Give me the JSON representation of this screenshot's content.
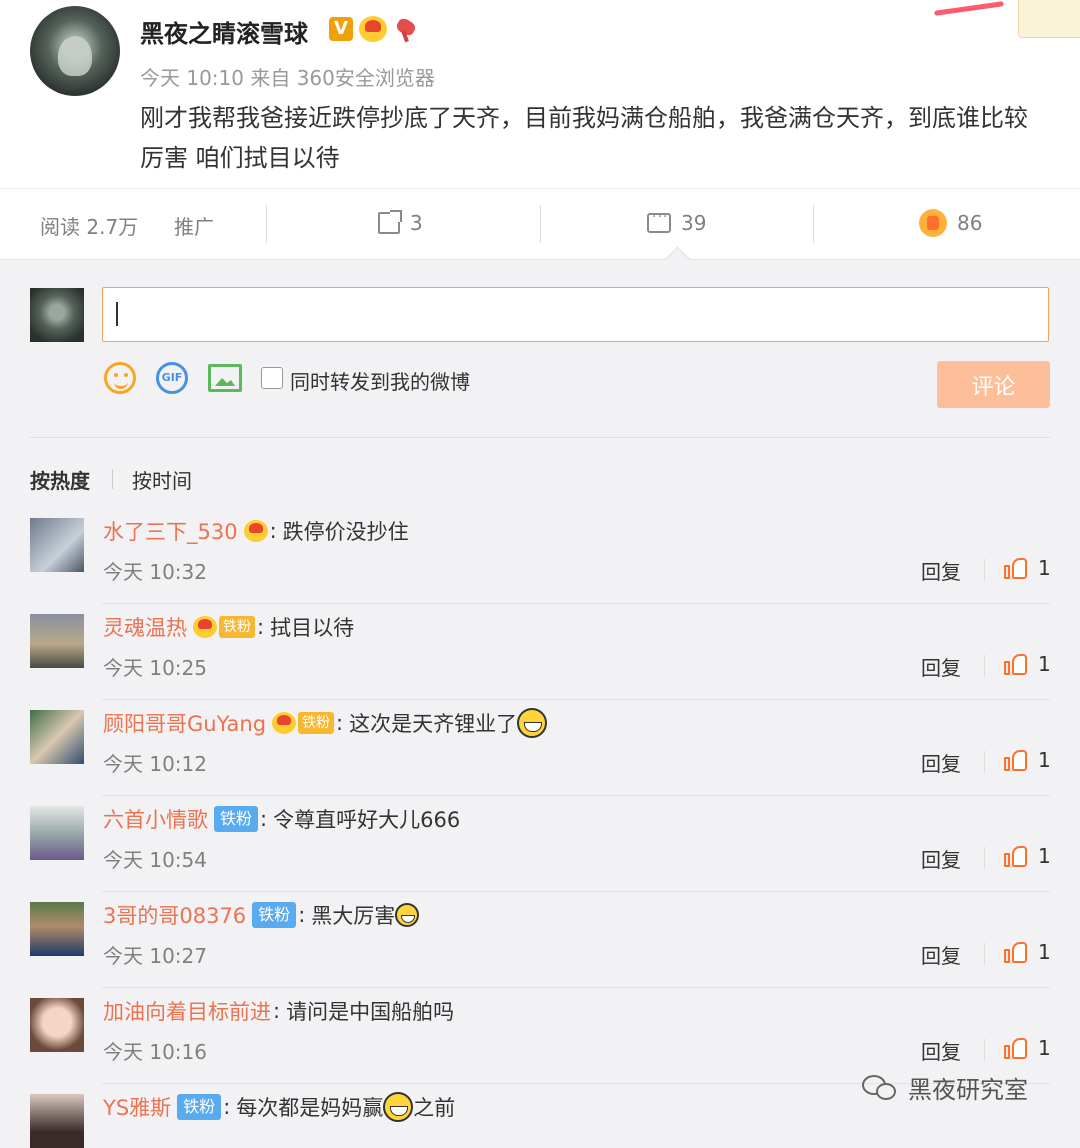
{
  "post": {
    "author": "黑夜之睛滚雪球",
    "verified_badge": "V",
    "meta": "今天 10:10 来自 360安全浏览器",
    "text": "刚才我帮我爸接近跌停抄底了天齐，目前我妈满仓船舶，我爸满仓天齐，到底谁比较厉害 咱们拭目以待"
  },
  "actions": {
    "read": "阅读 2.7万",
    "promote": "推广",
    "share_count": "3",
    "comment_count": "39",
    "like_count": "86"
  },
  "composer": {
    "input_value": "",
    "repost_label": "同时转发到我的微博",
    "submit_label": "评论",
    "gif_label": "GIF"
  },
  "sort": {
    "hot": "按热度",
    "time": "按时间"
  },
  "comments": [
    {
      "user": "水了三下_530",
      "text": "跌停价没抄住",
      "time": "今天 10:32",
      "reply": "回复",
      "likes": "1"
    },
    {
      "user": "灵魂温热",
      "fan": "铁粉",
      "text": "拭目以待",
      "time": "今天 10:25",
      "reply": "回复",
      "likes": "1"
    },
    {
      "user": "顾阳哥哥GuYang",
      "fan": "铁粉",
      "text": "这次是天齐锂业了",
      "time": "今天 10:12",
      "reply": "回复",
      "likes": "1"
    },
    {
      "user": "六首小情歌",
      "fan": "铁粉",
      "text": "令尊直呼好大儿666",
      "time": "今天 10:54",
      "reply": "回复",
      "likes": "1"
    },
    {
      "user": "3哥的哥08376",
      "fan": "铁粉",
      "text": "黑大厉害",
      "time": "今天 10:27",
      "reply": "回复",
      "likes": "1"
    },
    {
      "user": "加油向着目标前进",
      "text": "请问是中国船舶吗",
      "time": "今天 10:16",
      "reply": "回复",
      "likes": "1"
    },
    {
      "user": "YS雅斯",
      "fan": "铁粉",
      "text": "每次都是妈妈赢",
      "text2": "之前"
    }
  ],
  "watermark": "黑夜研究室",
  "colors": {
    "username": "#eb7350",
    "accent_orange": "#ff6f2c",
    "submit_disabled": "#fcbf9a",
    "fan_blue": "#5aaaf0"
  }
}
